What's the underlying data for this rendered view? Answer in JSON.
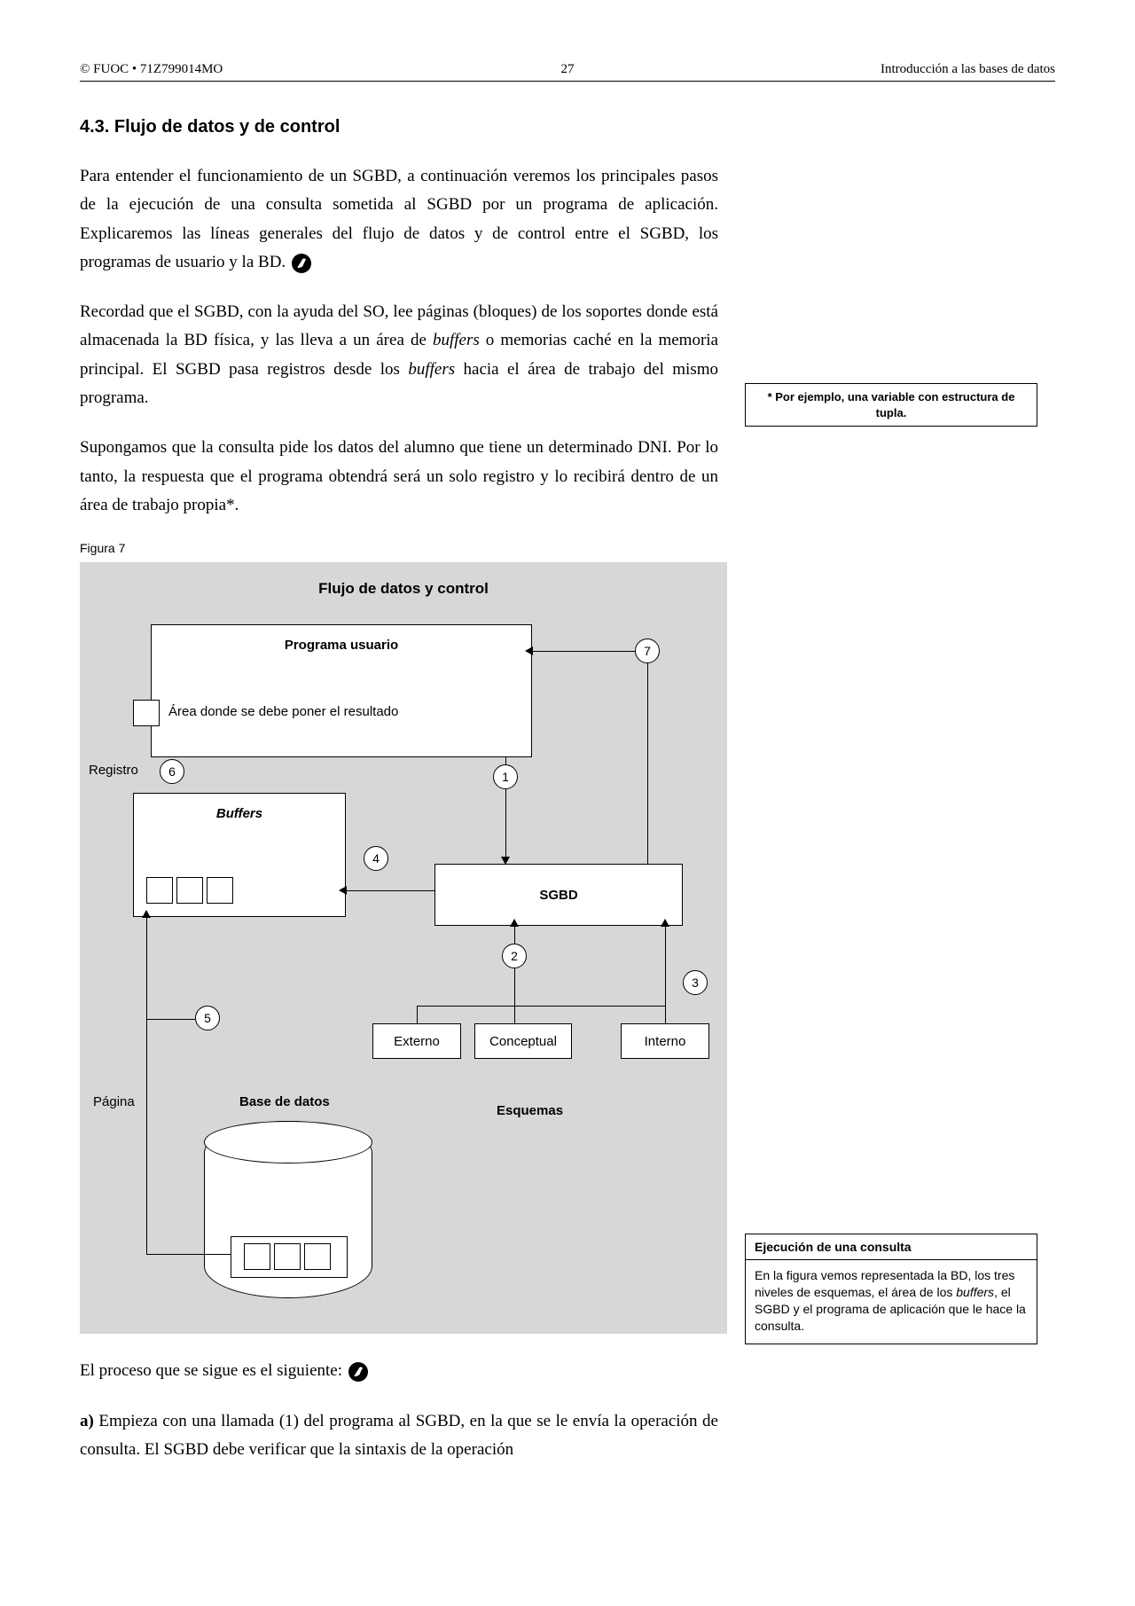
{
  "header": {
    "left": "© FUOC • 71Z799014MO",
    "center": "27",
    "right": "Introducción a las bases de datos"
  },
  "section_title": "4.3.  Flujo de datos y de control",
  "paragraphs": {
    "p1a": "Para entender el funcionamiento de un SGBD, a continuación veremos los principales pasos de la ejecución de una consulta sometida al SGBD por un programa de aplicación. Explicaremos las líneas generales del flujo de datos y de control entre el SGBD, los programas de usuario y la BD.",
    "p2a": "Recordad que el SGBD, con la ayuda del SO, lee páginas (bloques) de los soportes donde está almacenada la BD física, y las lleva a un área de ",
    "p2b": "buffers",
    "p2c": " o memorias caché en la memoria principal. El SGBD pasa registros desde los ",
    "p2d": "buffers",
    "p2e": " hacia el área de trabajo del mismo programa.",
    "p3": "Supongamos que la consulta pide los datos del alumno que tiene un determinado DNI. Por lo tanto, la respuesta que el programa obtendrá será un solo registro y lo recibirá dentro de un área de trabajo propia*.",
    "p4": "El proceso que se sigue es el siguiente:",
    "p5_prefix": "a)",
    "p5": "  Empieza con una llamada (1) del programa al SGBD, en la que se le envía la operación de consulta. El SGBD debe verificar que la sintaxis de la operación"
  },
  "figure_label": "Figura 7",
  "sidebar": {
    "note": "* Por ejemplo, una variable con estructura de tupla.",
    "box_title": "Ejecución de una consulta",
    "box_body_a": "En la figura vemos representada la BD, los tres niveles de esquemas, el área de los ",
    "box_body_b": "buffers",
    "box_body_c": ", el SGBD y el programa de aplicación que le hace la consulta."
  },
  "diagram": {
    "title": "Flujo de datos y control",
    "programa_usuario": "Programa usuario",
    "area_resultado": "Área donde se debe poner el resultado",
    "registro": "Registro",
    "buffers": "Buffers",
    "sgbd": "SGBD",
    "externo": "Externo",
    "conceptual": "Conceptual",
    "interno": "Interno",
    "pagina": "Página",
    "base_de_datos": "Base de datos",
    "esquemas": "Esquemas",
    "n1": "1",
    "n2": "2",
    "n3": "3",
    "n4": "4",
    "n5": "5",
    "n6": "6",
    "n7": "7"
  }
}
